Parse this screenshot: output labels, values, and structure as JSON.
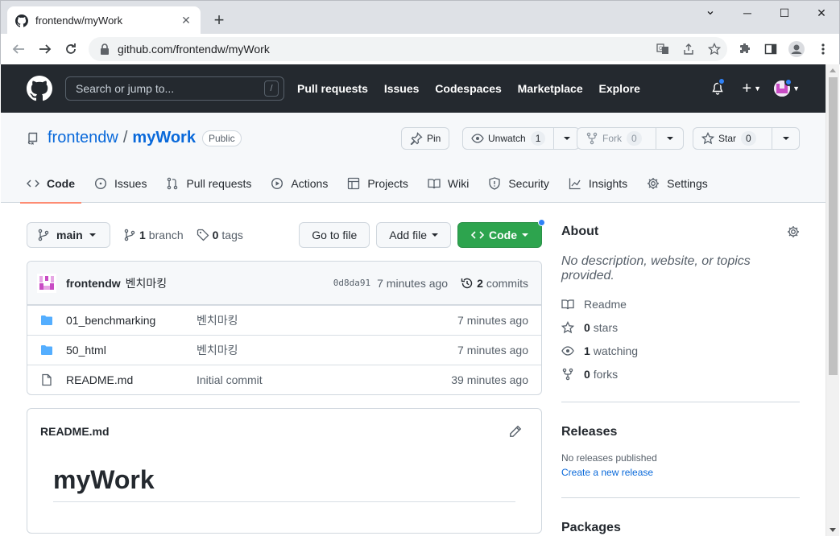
{
  "browser": {
    "tab_title": "frontendw/myWork",
    "tab_close": "✕",
    "new_tab": "+",
    "url": "github.com/frontendw/myWork",
    "win_min": "─",
    "win_max": "☐",
    "win_close": "✕",
    "win_down": "⌄"
  },
  "gh_header": {
    "search_placeholder": "Search or jump to...",
    "search_kbd": "/",
    "nav": [
      "Pull requests",
      "Issues",
      "Codespaces",
      "Marketplace",
      "Explore"
    ],
    "plus": "+"
  },
  "repo": {
    "owner": "frontendw",
    "separator": "/",
    "name": "myWork",
    "visibility": "Public",
    "pin_label": "Pin",
    "unwatch_label": "Unwatch",
    "watch_count": "1",
    "fork_label": "Fork",
    "fork_count": "0",
    "star_label": "Star",
    "star_count": "0"
  },
  "tabs": [
    "Code",
    "Issues",
    "Pull requests",
    "Actions",
    "Projects",
    "Wiki",
    "Security",
    "Insights",
    "Settings"
  ],
  "filenav": {
    "branch": "main",
    "branch_count": "1",
    "branch_word": "branch",
    "tag_count": "0",
    "tag_word": "tags",
    "go_to_file": "Go to file",
    "add_file": "Add file",
    "code": "Code"
  },
  "commit": {
    "author": "frontendw",
    "message": "벤치마킹",
    "sha": "0d8da91",
    "time": "7 minutes ago",
    "count": "2",
    "count_word": "commits"
  },
  "files": [
    {
      "name": "01_benchmarking",
      "type": "folder",
      "message": "벤치마킹",
      "time": "7 minutes ago"
    },
    {
      "name": "50_html",
      "type": "folder",
      "message": "벤치마킹",
      "time": "7 minutes ago"
    },
    {
      "name": "README.md",
      "type": "file",
      "message": "Initial commit",
      "time": "39 minutes ago"
    }
  ],
  "readme": {
    "filename": "README.md",
    "heading": "myWork"
  },
  "about": {
    "title": "About",
    "description": "No description, website, or topics provided.",
    "readme": "Readme",
    "stars_count": "0",
    "stars_word": "stars",
    "watching_count": "1",
    "watching_word": "watching",
    "forks_count": "0",
    "forks_word": "forks"
  },
  "releases": {
    "title": "Releases",
    "none": "No releases published",
    "create_link": "Create a new release"
  },
  "packages": {
    "title": "Packages"
  },
  "colors": {
    "header_bg": "#24292f",
    "link": "#0969da",
    "code_button": "#2da44e",
    "tab_underline": "#fd8c73",
    "notification_dot": "#2f81f7",
    "folder": "#54aeff"
  }
}
